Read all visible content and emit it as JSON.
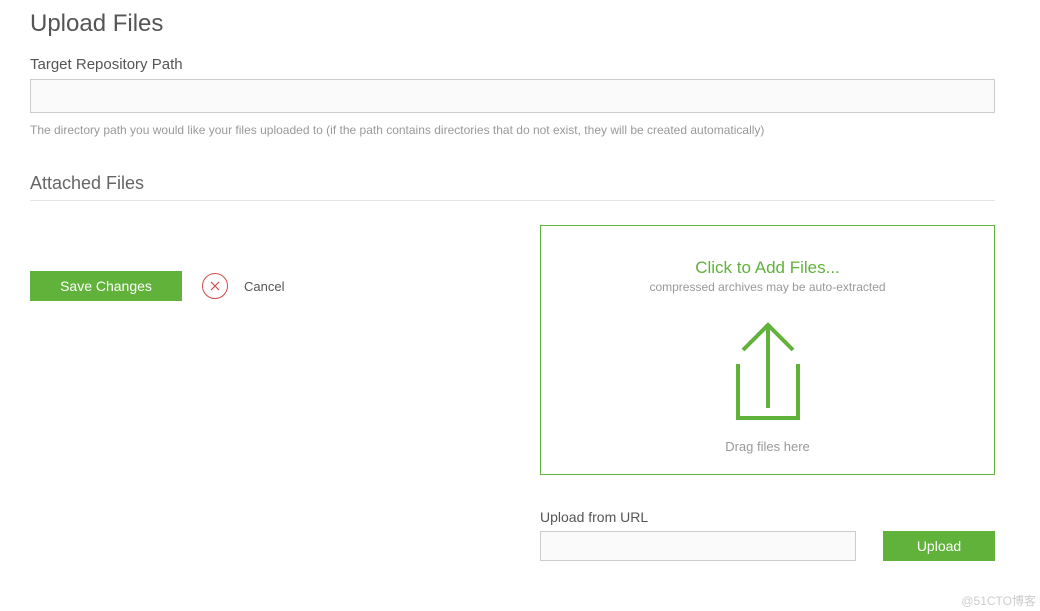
{
  "page": {
    "title": "Upload Files"
  },
  "targetField": {
    "label": "Target Repository Path",
    "value": "",
    "helper": "The directory path you would like your files uploaded to (if the path contains directories that do not exist, they will be created automatically)"
  },
  "attached": {
    "title": "Attached Files"
  },
  "actions": {
    "save": "Save Changes",
    "cancel": "Cancel"
  },
  "dropzone": {
    "title": "Click to Add Files...",
    "subtitle": "compressed archives may be auto-extracted",
    "dragText": "Drag files here"
  },
  "uploadUrl": {
    "label": "Upload from URL",
    "value": "",
    "button": "Upload"
  },
  "watermark": "@51CTO博客"
}
